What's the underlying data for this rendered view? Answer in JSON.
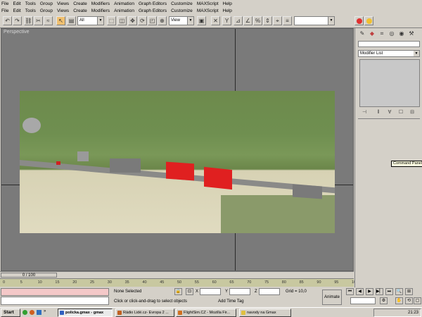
{
  "menus": [
    "File",
    "Edit",
    "Tools",
    "Group",
    "Views",
    "Create",
    "Modifiers",
    "Animation",
    "Graph Editors",
    "Customize",
    "MAXScript",
    "Help"
  ],
  "toolbar": {
    "selection_filter": "All",
    "ref_coord": "View",
    "named_selection": ""
  },
  "viewport": {
    "label": "Perspective"
  },
  "timeline": {
    "frame_indicator": "0 / 100",
    "ticks": [
      "0",
      "5",
      "10",
      "15",
      "20",
      "25",
      "30",
      "35",
      "40",
      "45",
      "50",
      "55",
      "60",
      "65",
      "70",
      "75",
      "80",
      "85",
      "90",
      "95",
      "100"
    ]
  },
  "status": {
    "selection": "None Selected",
    "prompt": "Click or click-and-drag to select objects",
    "x_label": "X",
    "y_label": "Y",
    "z_label": "Z",
    "grid": "Grid = 10,0",
    "time_tag": "Add Time Tag",
    "animate": "Animate"
  },
  "command_panel": {
    "modifier_list": "Modifier List",
    "tooltip": "Command Panel"
  },
  "taskbar": {
    "start": "Start",
    "tasks": [
      {
        "label": "policka.gmax - gmax",
        "active": true,
        "color": "#3060c0"
      },
      {
        "label": "Rádio Lidé.cz- Evropa 2 ...",
        "active": false,
        "color": "#c06020"
      },
      {
        "label": "FlightSim.CZ - Mozilla Fir...",
        "active": false,
        "color": "#d07020"
      },
      {
        "label": "navody na Gmax",
        "active": false,
        "color": "#e0c040"
      }
    ],
    "clock": "21:23"
  },
  "colors": {
    "accent": "#f0c070",
    "red_roof": "#e02020",
    "gray_roof": "#7a7a7a"
  }
}
